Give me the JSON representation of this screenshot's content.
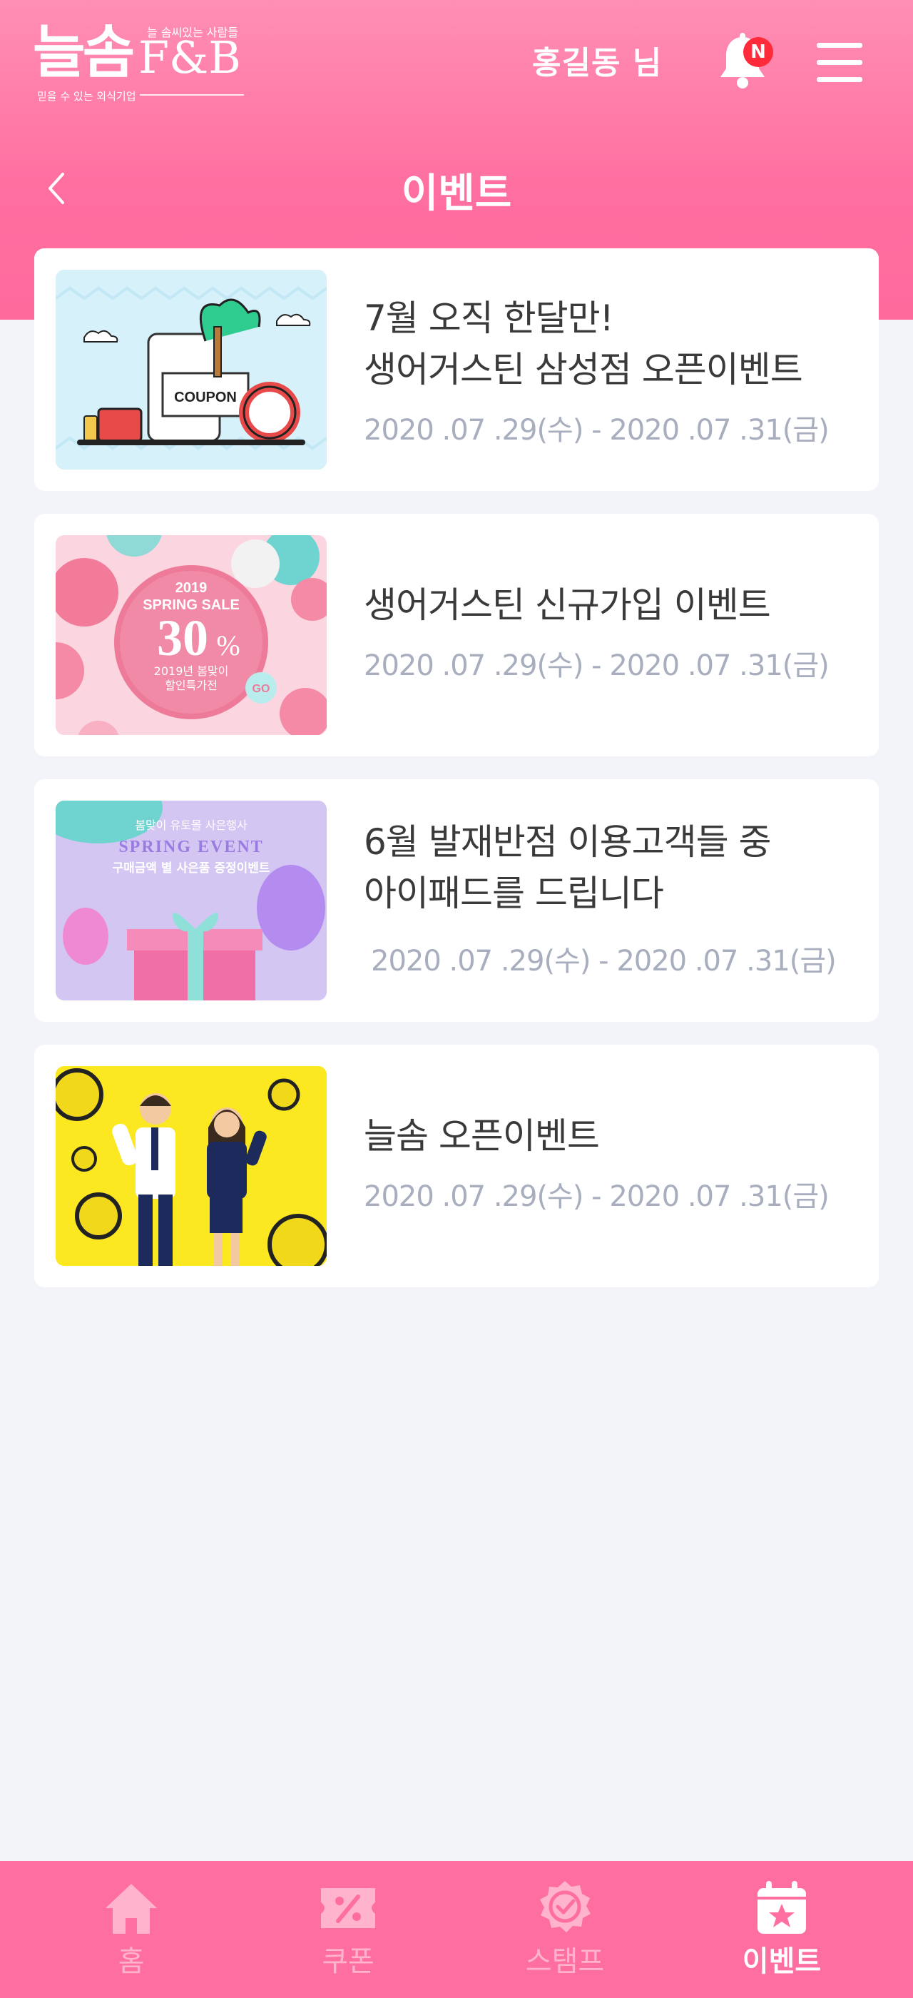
{
  "header": {
    "logo_main": "늘솜",
    "logo_fb": "F&B",
    "logo_tagline": "늘 솜씨있는 사람들",
    "logo_subtitle": "믿을 수 있는 외식기업",
    "username": "홍길동 님",
    "notification_badge": "N",
    "page_title": "이벤트"
  },
  "events": [
    {
      "title_lines": [
        "7월 오직 한달만!",
        "생어거스틴 삼성점 오픈이벤트"
      ],
      "date": "2020 .07 .29(수) - 2020 .07 .31(금)",
      "image_text": "COUPON"
    },
    {
      "title_lines": [
        "생어거스틴 신규가입 이벤트"
      ],
      "date": "2020 .07 .29(수) - 2020 .07 .31(금)",
      "image_year": "2019",
      "image_heading": "SPRING SALE",
      "image_percent": "30",
      "image_percent_sign": "%",
      "image_line1": "2019년 봄맞이",
      "image_line2": "할인특가전",
      "image_go": "GO"
    },
    {
      "title_lines": [
        "6월 발재반점 이용고객들 중",
        "아이패드를 드립니다"
      ],
      "date": "2020 .07 .29(수) - 2020 .07 .31(금)",
      "image_top": "봄맞이 유토몰 사은행사",
      "image_heading": "SPRING EVENT",
      "image_sub": "구매금액 별 사은품 증정이벤트"
    },
    {
      "title_lines": [
        "늘솜 오픈이벤트"
      ],
      "date": "2020 .07 .29(수) - 2020 .07 .31(금)"
    }
  ],
  "tabbar": {
    "tabs": [
      {
        "label": "홈",
        "icon": "home-icon"
      },
      {
        "label": "쿠폰",
        "icon": "coupon-icon"
      },
      {
        "label": "스탬프",
        "icon": "stamp-icon"
      },
      {
        "label": "이벤트",
        "icon": "calendar-star-icon",
        "active": true
      }
    ]
  },
  "colors": {
    "brand_pink": "#ff6ea0",
    "badge_red": "#ff2a3a",
    "date_gray": "#a8aebe"
  }
}
